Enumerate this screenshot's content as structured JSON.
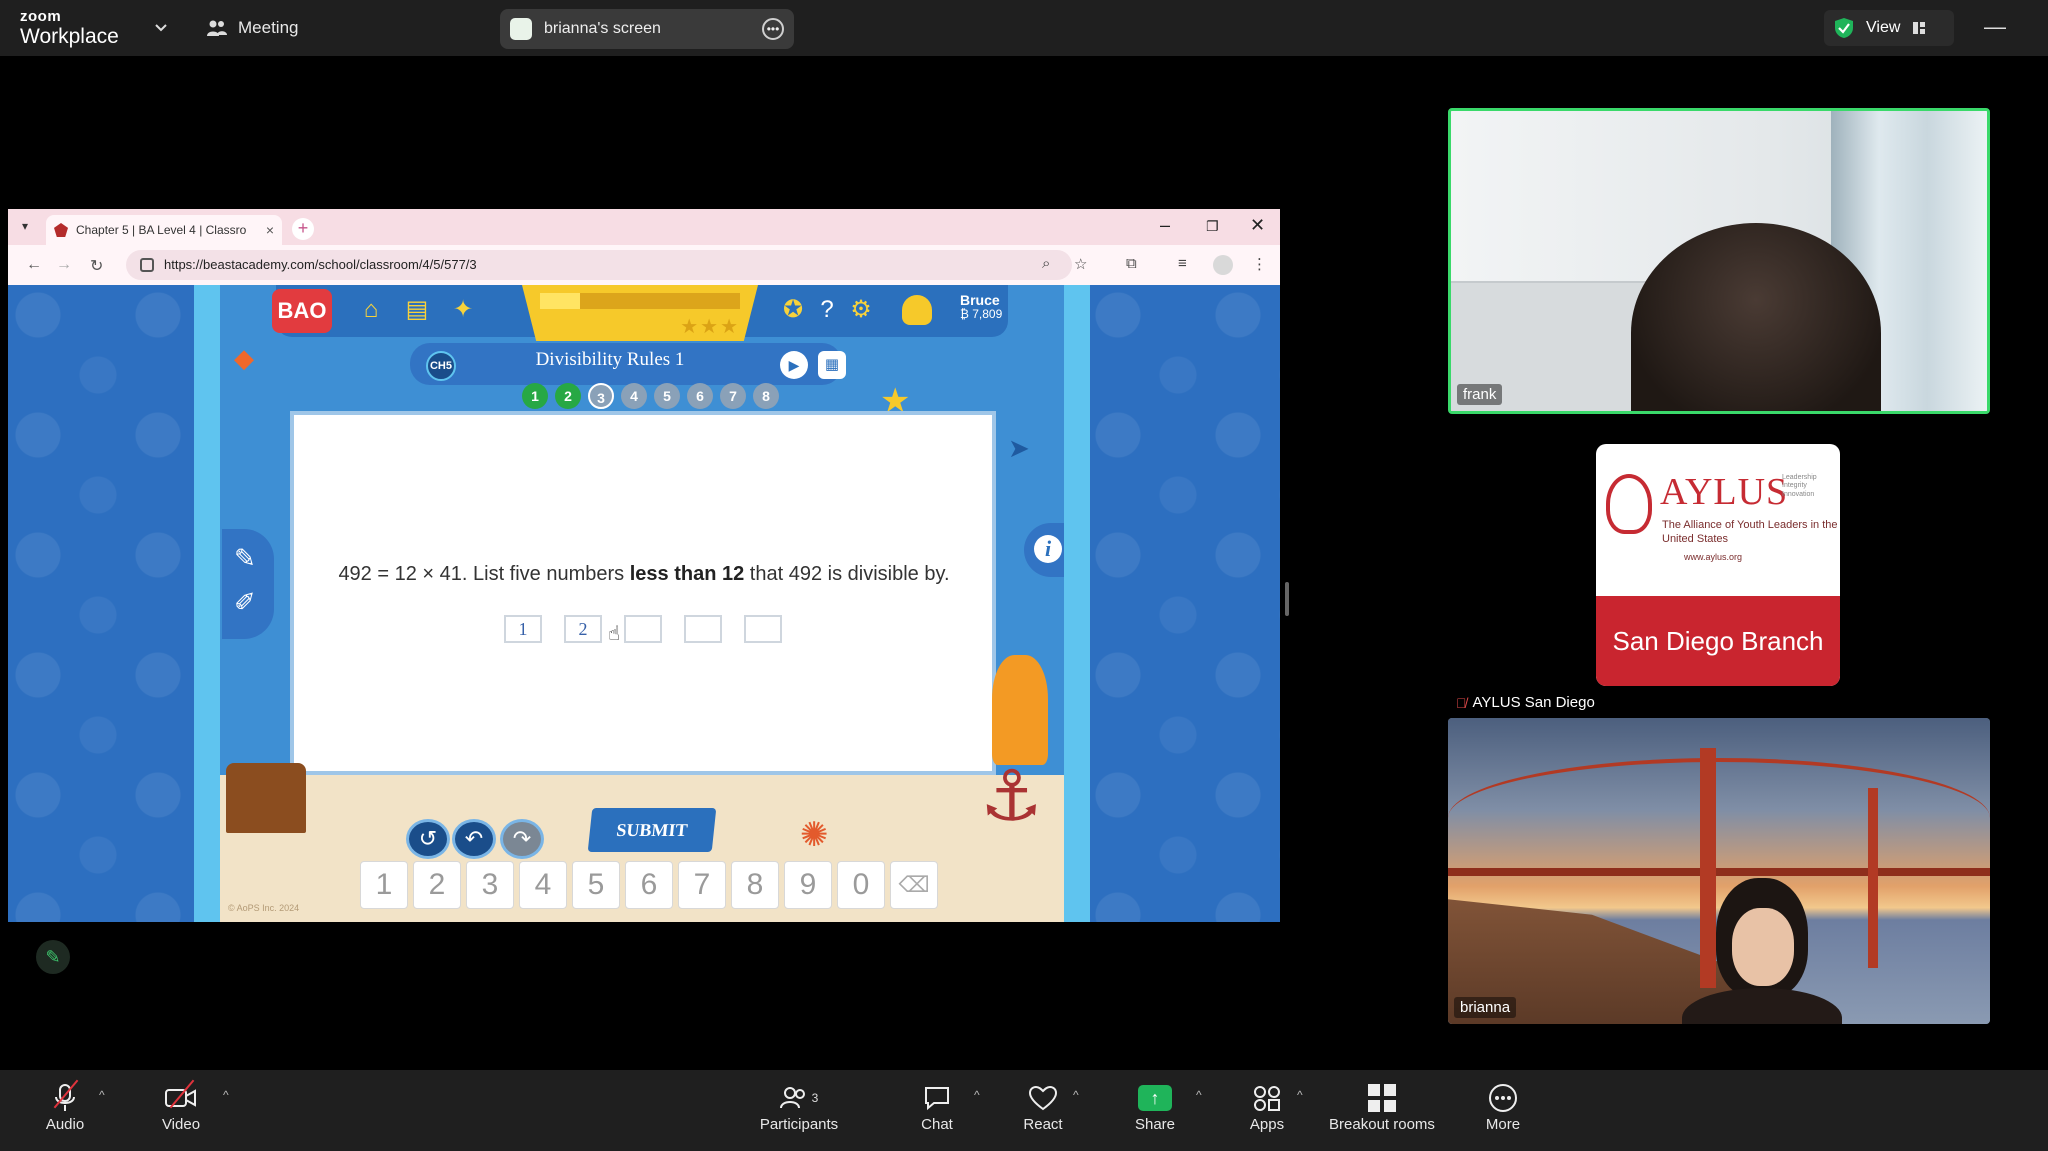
{
  "zoom": {
    "logo_top": "zoom",
    "logo_bottom": "Workplace",
    "meeting_label": "Meeting",
    "share_label": "brianna's screen",
    "view_label": "View"
  },
  "browser": {
    "tab_title": "Chapter 5 | BA Level 4 | Classro",
    "url": "https://beastacademy.com/school/classroom/4/5/577/3"
  },
  "game": {
    "logo": "BAO",
    "user_name": "Bruce",
    "user_coins": "₿ 7,809",
    "chapter_badge": "CH5",
    "lesson_title": "Divisibility Rules 1",
    "progress_fraction": 0.2,
    "problem_intro": "492 = 12 × 41. List five numbers ",
    "problem_bold": "less than 12",
    "problem_end": " that 492 is divisible by.",
    "answers": [
      "1",
      "2",
      "",
      "",
      ""
    ],
    "progress_dots": [
      "1",
      "2",
      "3",
      "4",
      "5",
      "6",
      "7",
      "8"
    ],
    "submit_label": "SUBMIT",
    "keypad": [
      "1",
      "2",
      "3",
      "4",
      "5",
      "6",
      "7",
      "8",
      "9",
      "0"
    ],
    "copyright": "© AoPS Inc. 2024"
  },
  "participants": {
    "frank": "frank",
    "aylus": "AYLUS San Diego",
    "brianna": "brianna",
    "aylus_card": {
      "name": "AYLUS",
      "tagline": [
        "Leadership",
        "Integrity",
        "Innovation"
      ],
      "subtitle": "The Alliance of Youth Leaders in the United States",
      "url": "www.aylus.org",
      "branch": "San Diego Branch"
    }
  },
  "toolbar": {
    "audio": "Audio",
    "video": "Video",
    "participants": "Participants",
    "participants_count": "3",
    "chat": "Chat",
    "react": "React",
    "share": "Share",
    "apps": "Apps",
    "breakout": "Breakout rooms",
    "more": "More"
  },
  "colors": {
    "zoom_bar": "#1f1f1f",
    "active_speaker": "#3ad96a",
    "share_green": "#1fb45a",
    "game_blue": "#2d6fc0",
    "aylus_red": "#c9252f"
  }
}
